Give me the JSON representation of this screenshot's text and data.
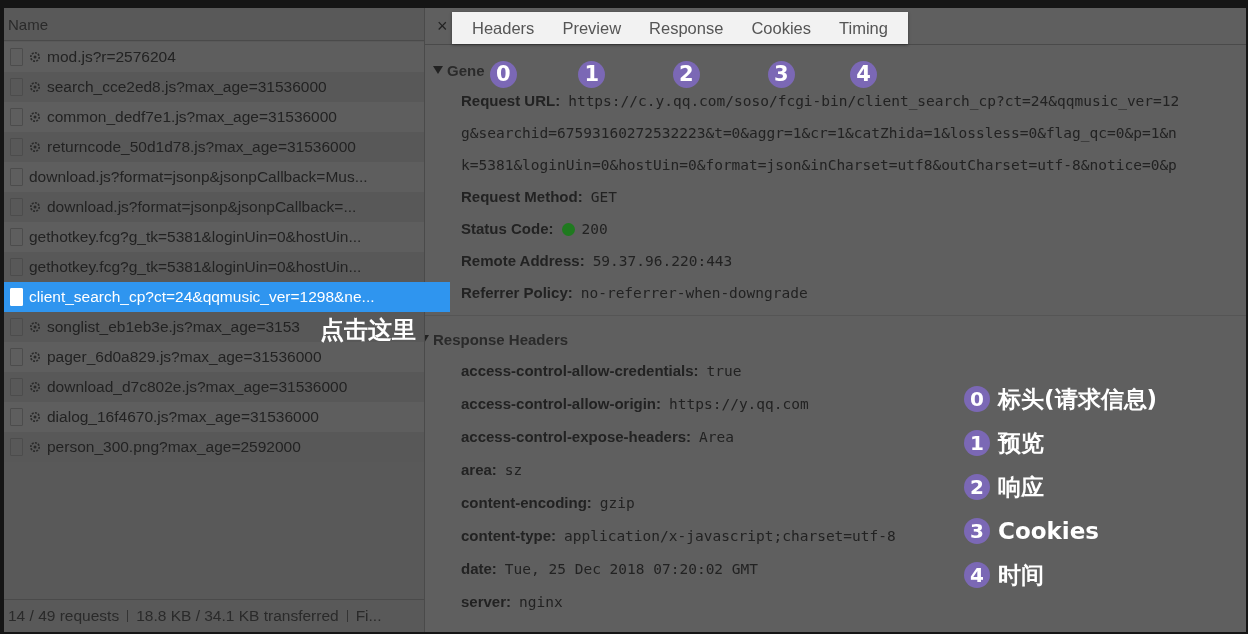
{
  "requests": {
    "column": "Name",
    "rows": [
      {
        "name": "mod.js?r=2576204",
        "kind": "cached",
        "selected": false
      },
      {
        "name": "search_cce2ed8.js?max_age=31536000",
        "kind": "cached",
        "selected": false
      },
      {
        "name": "common_dedf7e1.js?max_age=31536000",
        "kind": "cached",
        "selected": false
      },
      {
        "name": "returncode_50d1d78.js?max_age=31536000",
        "kind": "cached",
        "selected": false
      },
      {
        "name": "download.js?format=jsonp&jsonpCallback=Mus...",
        "kind": "plain",
        "selected": false
      },
      {
        "name": "download.js?format=jsonp&jsonpCallback=...",
        "kind": "cached",
        "selected": false
      },
      {
        "name": "gethotkey.fcg?g_tk=5381&loginUin=0&hostUin...",
        "kind": "plain",
        "selected": false
      },
      {
        "name": "gethotkey.fcg?g_tk=5381&loginUin=0&hostUin...",
        "kind": "plain",
        "selected": false
      },
      {
        "name": "client_search_cp?ct=24&qqmusic_ver=1298&ne...",
        "kind": "plain",
        "selected": true
      },
      {
        "name": "songlist_eb1eb3e.js?max_age=3153",
        "kind": "cached",
        "selected": false
      },
      {
        "name": "pager_6d0a829.js?max_age=31536000",
        "kind": "cached",
        "selected": false
      },
      {
        "name": "download_d7c802e.js?max_age=31536000",
        "kind": "cached",
        "selected": false
      },
      {
        "name": "dialog_16f4670.js?max_age=31536000",
        "kind": "cached",
        "selected": false
      },
      {
        "name": "person_300.png?max_age=2592000",
        "kind": "cached",
        "selected": false
      }
    ],
    "status_bar": [
      "14 / 49 requests",
      "18.8 KB / 34.1 KB transferred",
      "Fi..."
    ]
  },
  "callout": "点击这里",
  "close": "×",
  "tabs": [
    {
      "label": "Headers",
      "badge": "0"
    },
    {
      "label": "Preview",
      "badge": "1"
    },
    {
      "label": "Response",
      "badge": "2"
    },
    {
      "label": "Cookies",
      "badge": "3"
    },
    {
      "label": "Timing",
      "badge": "4"
    }
  ],
  "general": {
    "title": "Gene",
    "fields": [
      {
        "label": "Request URL:",
        "lines": [
          "https://c.y.qq.com/soso/fcgi-bin/client_search_cp?ct=24&qqmusic_ver=12",
          "g&searchid=67593160272532223&t=0&aggr=1&cr=1&catZhida=1&lossless=0&flag_qc=0&p=1&n",
          "k=5381&loginUin=0&hostUin=0&format=json&inCharset=utf8&outCharset=utf-8&notice=0&p"
        ]
      },
      {
        "label": "Request Method:",
        "lines": [
          "GET"
        ]
      },
      {
        "label": "Status Code:",
        "lines": [
          "200"
        ],
        "color": "#1f7a1f"
      },
      {
        "label": "Remote Address:",
        "lines": [
          "59.37.96.220:443"
        ]
      },
      {
        "label": "Referrer Policy:",
        "lines": [
          "no-referrer-when-downgrade"
        ]
      }
    ]
  },
  "response_headers": {
    "title": "Response Headers",
    "fields": [
      {
        "label": "access-control-allow-credentials:",
        "value": "true"
      },
      {
        "label": "access-control-allow-origin:",
        "value": "https://y.qq.com"
      },
      {
        "label": "access-control-expose-headers:",
        "value": "Area"
      },
      {
        "label": "area:",
        "value": "sz"
      },
      {
        "label": "content-encoding:",
        "value": "gzip"
      },
      {
        "label": "content-type:",
        "value": "application/x-javascript;charset=utf-8"
      },
      {
        "label": "date:",
        "value": "Tue, 25 Dec 2018 07:20:02 GMT"
      },
      {
        "label": "server:",
        "value": "nginx"
      }
    ]
  },
  "legend": [
    {
      "badge": "0",
      "text": "标头(请求信息)"
    },
    {
      "badge": "1",
      "text": "预览"
    },
    {
      "badge": "2",
      "text": "响应"
    },
    {
      "badge": "3",
      "text": "Cookies"
    },
    {
      "badge": "4",
      "text": "时间"
    }
  ]
}
